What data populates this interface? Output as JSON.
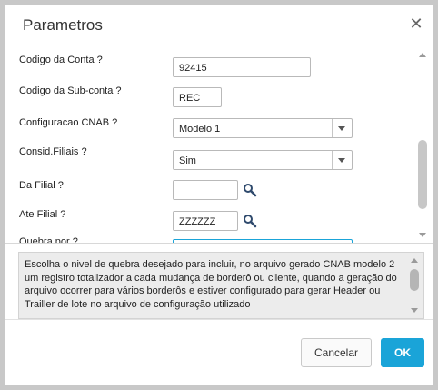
{
  "dialog": {
    "title": "Parametros",
    "close_icon": "close-icon"
  },
  "form": {
    "conta": {
      "label": "Codigo da Conta ?",
      "value": "92415"
    },
    "subconta": {
      "label": "Codigo da Sub-conta ?",
      "value": "REC"
    },
    "cnab": {
      "label": "Configuracao CNAB ?",
      "value": "Modelo 1"
    },
    "consid": {
      "label": "Consid.Filiais ?",
      "value": "Sim"
    },
    "da_filial": {
      "label": "Da Filial ?",
      "value": "",
      "icon": "search-icon"
    },
    "ate_filial": {
      "label": "Ate Filial ?",
      "value": "ZZZZZZ",
      "icon": "search-icon"
    },
    "quebra": {
      "label": "Quebra por ?"
    }
  },
  "help": {
    "text": "Escolha o nivel de quebra desejado para incluir, no arquivo gerado CNAB modelo 2 um registro totalizador a cada mudança de borderô ou cliente, quando a geração do arquivo ocorrer para vários borderôs e estiver configurado para gerar Header ou Trailler de lote no arquivo de configuração utilizado"
  },
  "footer": {
    "cancel_label": "Cancelar",
    "ok_label": "OK"
  },
  "colors": {
    "ok_button": "#1aa4d8",
    "frame": "#c8c8c8"
  }
}
